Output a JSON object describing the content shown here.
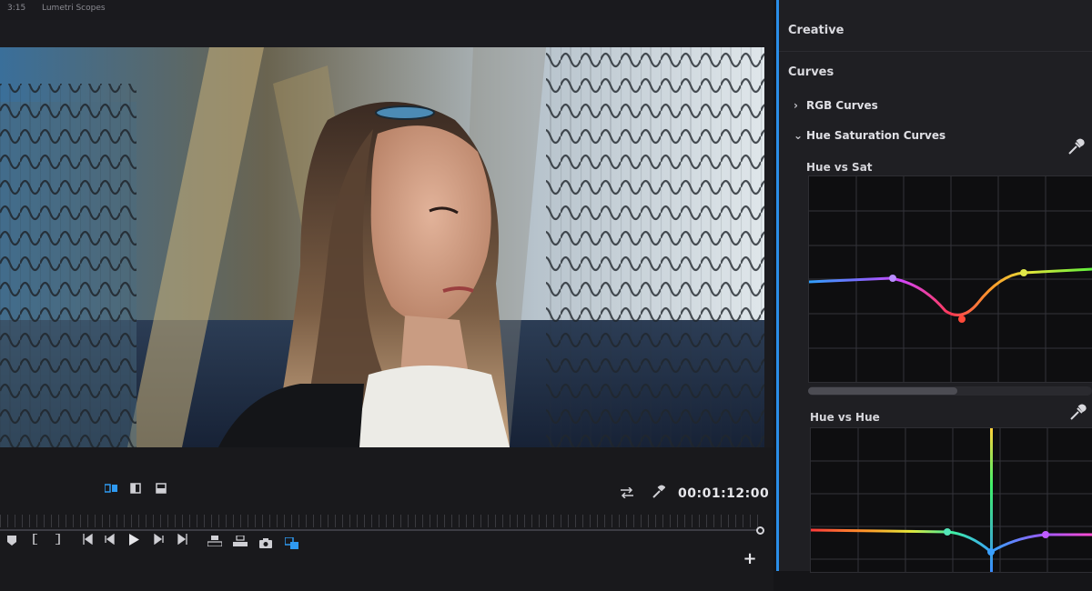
{
  "top_bar": {
    "timecode": "3:15",
    "title": "Lumetri Scopes"
  },
  "video": {
    "subject": "portrait"
  },
  "controls": {
    "timecode": "00:01:12:00",
    "view_icons": [
      "multi-view-icon",
      "split-view-icon",
      "single-view-icon"
    ],
    "transport_icons": [
      "add-marker-icon",
      "mark-in-icon",
      "mark-out-icon",
      "go-to-in-icon",
      "step-back-icon",
      "play-icon",
      "step-forward-icon",
      "go-to-out-icon",
      "lift-icon",
      "extract-icon",
      "export-frame-icon",
      "comparison-view-icon"
    ],
    "add_button": "+"
  },
  "lumetri": {
    "creative_label": "Creative",
    "curves_label": "Curves",
    "rgb_curves_label": "RGB Curves",
    "hue_sat_curves_label": "Hue Saturation Curves",
    "hue_vs_sat_label": "Hue vs Sat",
    "hue_vs_hue_label": "Hue vs Hue",
    "accent": "#2a8ee8"
  }
}
